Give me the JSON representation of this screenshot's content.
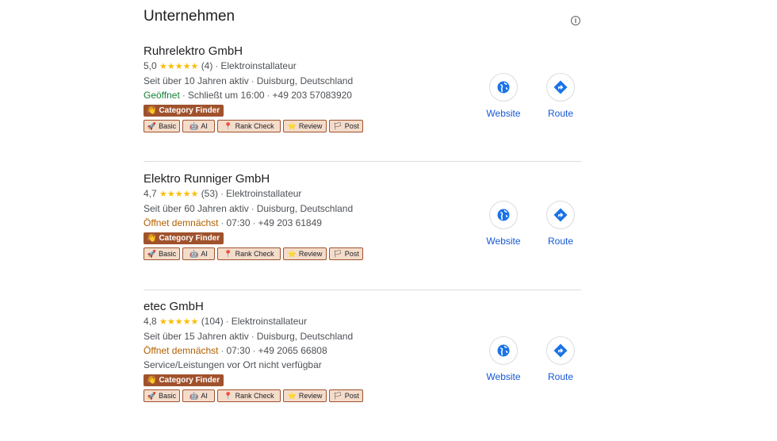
{
  "header": {
    "title": "Unternehmen",
    "info_glyph": "i"
  },
  "common": {
    "category_finder": "Category Finder",
    "website_label": "Website",
    "route_label": "Route",
    "tools": [
      "Basic",
      "AI",
      "Rank Check",
      "Review",
      "Post"
    ],
    "colors": {
      "open": "#188038",
      "soon": "#b06000",
      "star": "#fbbc04",
      "badge": "#a0522d",
      "action": "#1558d6"
    }
  },
  "businesses": [
    {
      "name": "Ruhrelektro GmbH",
      "rating": "5,0",
      "stars": "★★★★★",
      "reviews": "(4)",
      "category": "Elektroinstallateur",
      "years": "Seit über 10 Jahren aktiv",
      "location": "Duisburg, Deutschland",
      "status": "Geöffnet",
      "hours": "Schließt um 16:00",
      "phone": "+49 203 57083920",
      "note": ""
    },
    {
      "name": "Elektro Runniger GmbH",
      "rating": "4,7",
      "stars": "★★★★★",
      "reviews": "(53)",
      "category": "Elektroinstallateur",
      "years": "Seit über 60 Jahren aktiv",
      "location": "Duisburg, Deutschland",
      "status": "Öffnet demnächst",
      "hours": "07:30",
      "phone": "+49 203 61849",
      "note": ""
    },
    {
      "name": "etec GmbH",
      "rating": "4,8",
      "stars": "★★★★★",
      "reviews": "(104)",
      "category": "Elektroinstallateur",
      "years": "Seit über 15 Jahren aktiv",
      "location": "Duisburg, Deutschland",
      "status": "Öffnet demnächst",
      "hours": "07:30",
      "phone": "+49 2065 66808",
      "note": "Service/Leistungen vor Ort nicht verfügbar"
    }
  ]
}
